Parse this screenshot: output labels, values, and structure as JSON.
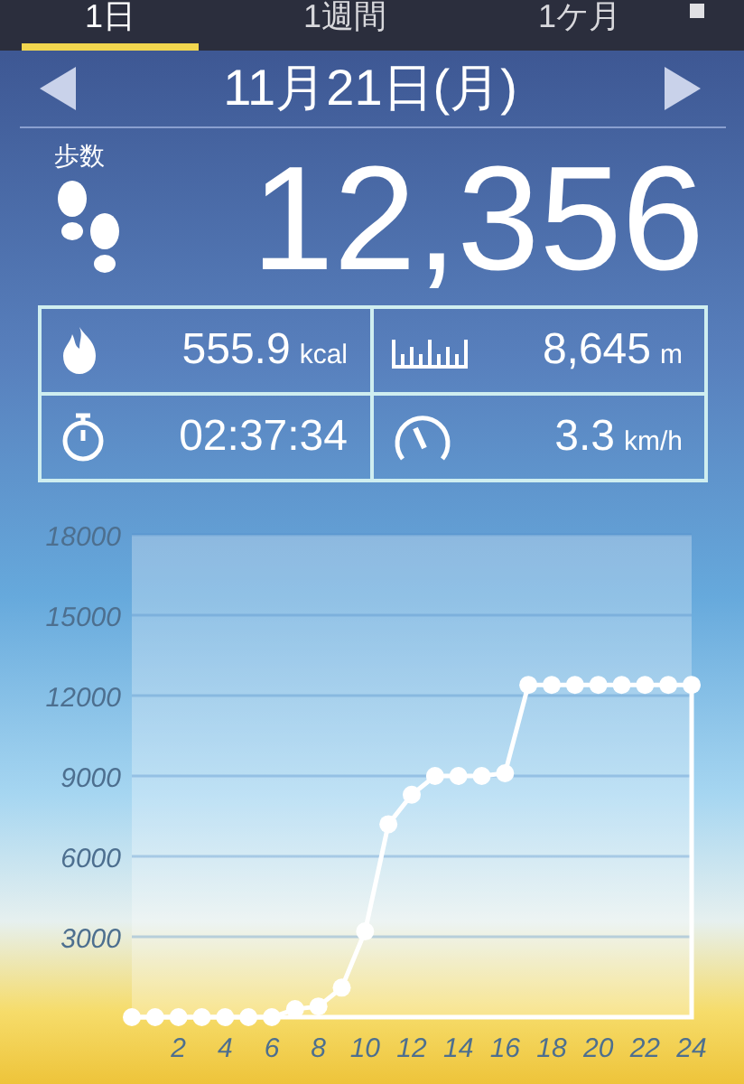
{
  "tabs": [
    {
      "label": "1日",
      "selected": true
    },
    {
      "label": "1週間",
      "selected": false
    },
    {
      "label": "1ケ月",
      "selected": false
    }
  ],
  "date": {
    "label": "11月21日(月)"
  },
  "steps": {
    "label": "歩数",
    "value": "12,356"
  },
  "stats": [
    {
      "kind": "calories",
      "value": "555.9",
      "unit": "kcal"
    },
    {
      "kind": "distance",
      "value": "8,645",
      "unit": "m"
    },
    {
      "kind": "time",
      "value": "02:37:34"
    },
    {
      "kind": "speed",
      "value": "3.3",
      "unit": "km/h"
    }
  ],
  "chart": {
    "chart_data": {
      "type": "line",
      "x": [
        0,
        1,
        2,
        3,
        4,
        5,
        6,
        7,
        8,
        9,
        10,
        11,
        12,
        13,
        14,
        15,
        16,
        17,
        18,
        19,
        20,
        21,
        22,
        23,
        24
      ],
      "values": [
        0,
        0,
        0,
        0,
        0,
        0,
        0,
        300,
        400,
        1100,
        3200,
        7200,
        8300,
        9000,
        9000,
        9000,
        9100,
        12400,
        12400,
        12400,
        12400,
        12400,
        12400,
        12400,
        12400
      ],
      "grid": true,
      "marker": true,
      "xlim": [
        0,
        24
      ],
      "ylim": [
        0,
        18000
      ],
      "xticks": [
        2,
        4,
        6,
        8,
        10,
        12,
        14,
        16,
        18,
        20,
        22,
        24
      ],
      "yticks": [
        3000,
        6000,
        9000,
        12000,
        15000,
        18000
      ]
    }
  }
}
